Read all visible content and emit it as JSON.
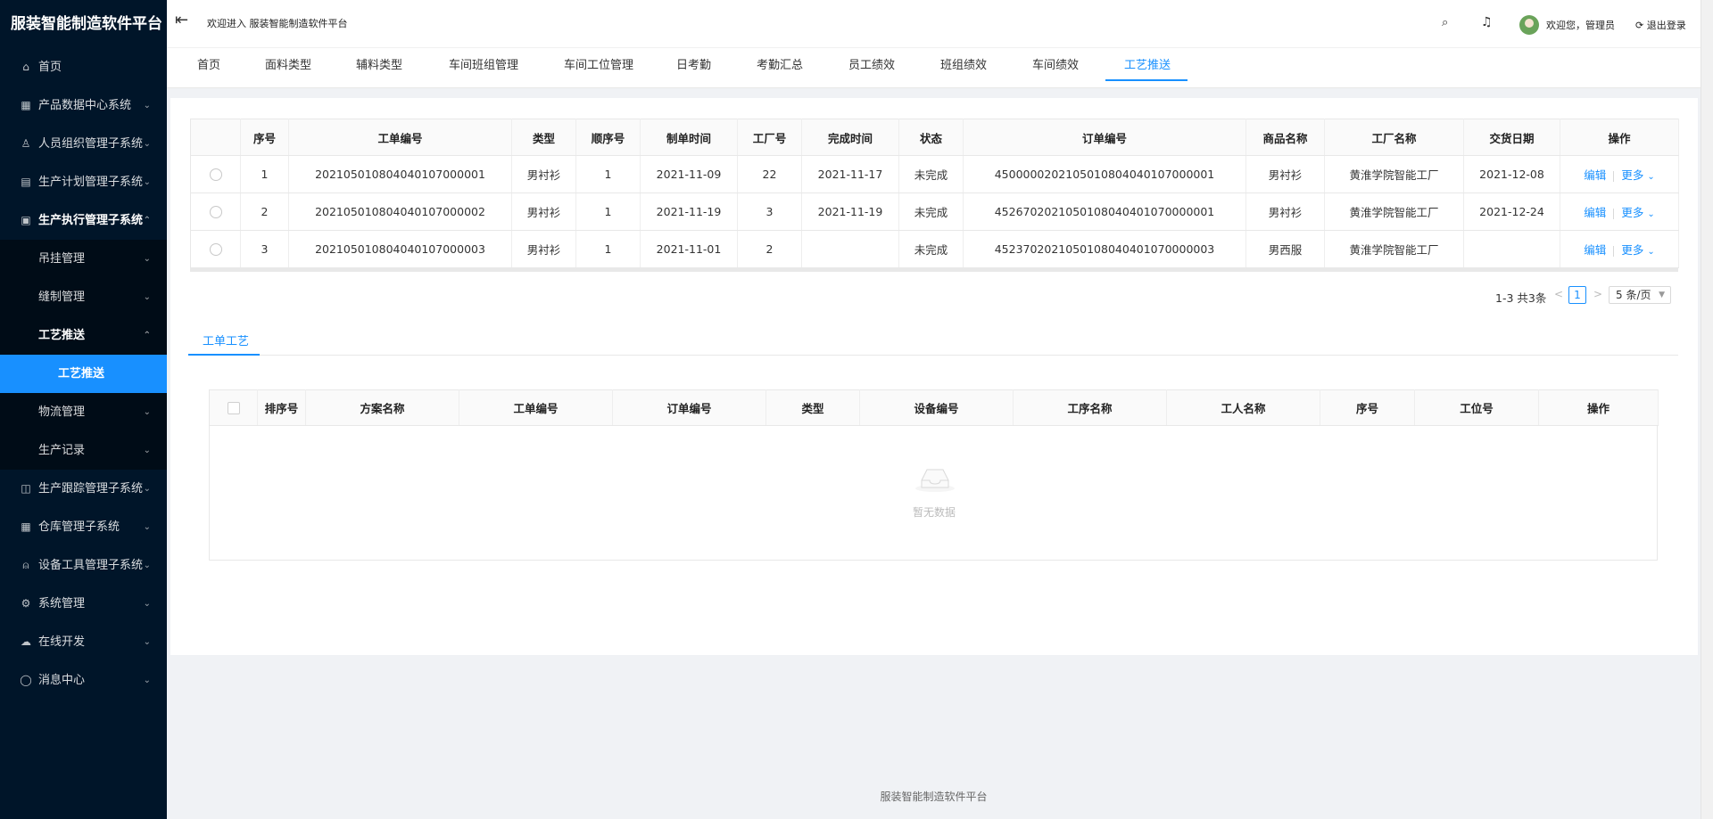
{
  "app": {
    "title": "服装智能制造软件平台",
    "footer": "服装智能制造软件平台"
  },
  "header": {
    "welcome": "欢迎进入 服装智能制造软件平台",
    "user_greeting": "欢迎您，管理员",
    "logout": "退出登录"
  },
  "sidebar": {
    "items": [
      {
        "label": "首页",
        "icon": "home-icon",
        "glyph": "⌂"
      },
      {
        "label": "产品数据中心系统",
        "icon": "bank-icon",
        "glyph": "▦",
        "arrow": "⌄"
      },
      {
        "label": "人员组织管理子系统",
        "icon": "user-icon",
        "glyph": "♙",
        "arrow": "⌄"
      },
      {
        "label": "生产计划管理子系统",
        "icon": "file-icon",
        "glyph": "▤",
        "arrow": "⌄"
      },
      {
        "label": "生产执行管理子系统",
        "icon": "exec-icon",
        "glyph": "▣",
        "arrow": "⌃"
      },
      {
        "label": "吊挂管理",
        "arrow": "⌄"
      },
      {
        "label": "缝制管理",
        "arrow": "⌄"
      },
      {
        "label": "工艺推送",
        "arrow": "⌃"
      },
      {
        "label": "工艺推送"
      },
      {
        "label": "物流管理",
        "arrow": "⌄"
      },
      {
        "label": "生产记录",
        "arrow": "⌄"
      },
      {
        "label": "生产跟踪管理子系统",
        "icon": "track-icon",
        "glyph": "◫",
        "arrow": "⌄"
      },
      {
        "label": "仓库管理子系统",
        "icon": "warehouse-icon",
        "glyph": "▦",
        "arrow": "⌄"
      },
      {
        "label": "设备工具管理子系统",
        "icon": "tool-icon",
        "glyph": "⍝",
        "arrow": "⌄"
      },
      {
        "label": "系统管理",
        "icon": "gear-icon",
        "glyph": "⚙",
        "arrow": "⌄"
      },
      {
        "label": "在线开发",
        "icon": "cloud-icon",
        "glyph": "☁",
        "arrow": "⌄"
      },
      {
        "label": "消息中心",
        "icon": "message-icon",
        "glyph": "◯",
        "arrow": "⌄"
      }
    ]
  },
  "tabs": [
    {
      "label": "首页"
    },
    {
      "label": "面料类型"
    },
    {
      "label": "辅料类型"
    },
    {
      "label": "车间班组管理"
    },
    {
      "label": "车间工位管理"
    },
    {
      "label": "日考勤"
    },
    {
      "label": "考勤汇总"
    },
    {
      "label": "员工绩效"
    },
    {
      "label": "班组绩效"
    },
    {
      "label": "车间绩效"
    },
    {
      "label": "工艺推送"
    }
  ],
  "main_table": {
    "columns": [
      "序号",
      "工单编号",
      "类型",
      "顺序号",
      "制单时间",
      "工厂号",
      "完成时间",
      "状态",
      "订单编号",
      "商品名称",
      "工厂名称",
      "交货日期",
      "操作"
    ],
    "rows": [
      [
        "1",
        "202105010804040107000001",
        "男衬衫",
        "1",
        "2021-11-09",
        "22",
        "2021-11-17",
        "未完成",
        "4500000202105010804040107000001",
        "男衬衫",
        "黄淮学院智能工厂",
        "2021-12-08"
      ],
      [
        "2",
        "202105010804040107000002",
        "男衬衫",
        "1",
        "2021-11-19",
        "3",
        "2021-11-19",
        "未完成",
        "4526702021050108040401070000001",
        "男衬衫",
        "黄淮学院智能工厂",
        "2021-12-24"
      ],
      [
        "3",
        "202105010804040107000003",
        "男衬衫",
        "1",
        "2021-11-01",
        "2",
        "",
        "未完成",
        "4523702021050108040401070000003",
        "男西服",
        "黄淮学院智能工厂",
        ""
      ]
    ],
    "edit_label": "编辑",
    "more_label": "更多"
  },
  "pagination": {
    "total": "1-3 共3条",
    "current": "1",
    "page_size": "5 条/页"
  },
  "sub_tab": {
    "label": "工单工艺"
  },
  "detail_table": {
    "columns": [
      "排序号",
      "方案名称",
      "工单编号",
      "订单编号",
      "类型",
      "设备编号",
      "工序名称",
      "工人名称",
      "序号",
      "工位号",
      "操作"
    ],
    "empty_text": "暂无数据"
  },
  "colors": {
    "sidebar_bg": "#001529",
    "accent": "#1890ff"
  }
}
